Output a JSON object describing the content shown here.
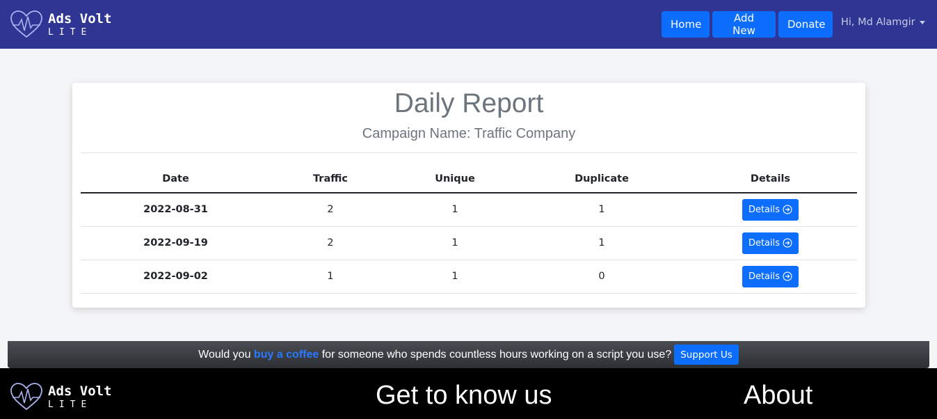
{
  "brand": {
    "name": "Ads Volt",
    "tagline": "LITE"
  },
  "nav": {
    "home": "Home",
    "add_new": "Add New",
    "donate": "Donate",
    "user": "Hi, Md Alamgir"
  },
  "report": {
    "title": "Daily Report",
    "subtitle": "Campaign Name: Traffic Company",
    "columns": [
      "Date",
      "Traffic",
      "Unique",
      "Duplicate",
      "Details"
    ],
    "rows": [
      {
        "date": "2022-08-31",
        "traffic": "2",
        "unique": "1",
        "duplicate": "1",
        "details": "Details"
      },
      {
        "date": "2022-09-19",
        "traffic": "2",
        "unique": "1",
        "duplicate": "1",
        "details": "Details"
      },
      {
        "date": "2022-09-02",
        "traffic": "1",
        "unique": "1",
        "duplicate": "0",
        "details": "Details"
      }
    ]
  },
  "support": {
    "prefix": "Would you ",
    "link": "buy a coffee",
    "suffix": " for someone who spends countless hours working on a script you use?",
    "button": "Support Us"
  },
  "footer": {
    "heading_1": "Get to know us",
    "heading_2": "About"
  },
  "colors": {
    "navbar": "#2e3592",
    "primary": "#0d6efd",
    "footer": "#000000"
  }
}
